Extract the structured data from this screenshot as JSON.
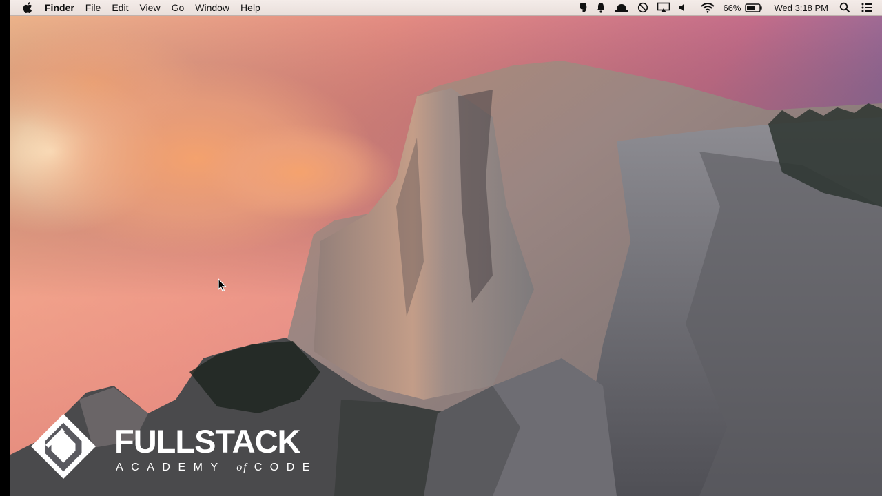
{
  "menubar": {
    "apple_icon": "apple-logo-icon",
    "app_name": "Finder",
    "menus": [
      "File",
      "Edit",
      "View",
      "Go",
      "Window",
      "Help"
    ],
    "status": {
      "battery_percent": "66%",
      "datetime": "Wed 3:18 PM",
      "icons": [
        "evernote-icon",
        "notification-bell-icon",
        "hat-icon",
        "do-not-disturb-icon",
        "airplay-icon",
        "volume-icon",
        "wifi-icon",
        "battery-icon",
        "spotlight-search-icon",
        "notification-center-icon"
      ]
    }
  },
  "desktop": {
    "wallpaper": "yosemite-half-dome",
    "colors": {
      "sky_top": "#e49a84",
      "sky_purple": "#8a6e9e",
      "cloud": "#f0a173",
      "rock": "#8a8584"
    }
  },
  "watermark": {
    "title": "FULLSTACK",
    "subtitle_left": "ACADEMY",
    "subtitle_of": "of",
    "subtitle_right": "CODE"
  }
}
